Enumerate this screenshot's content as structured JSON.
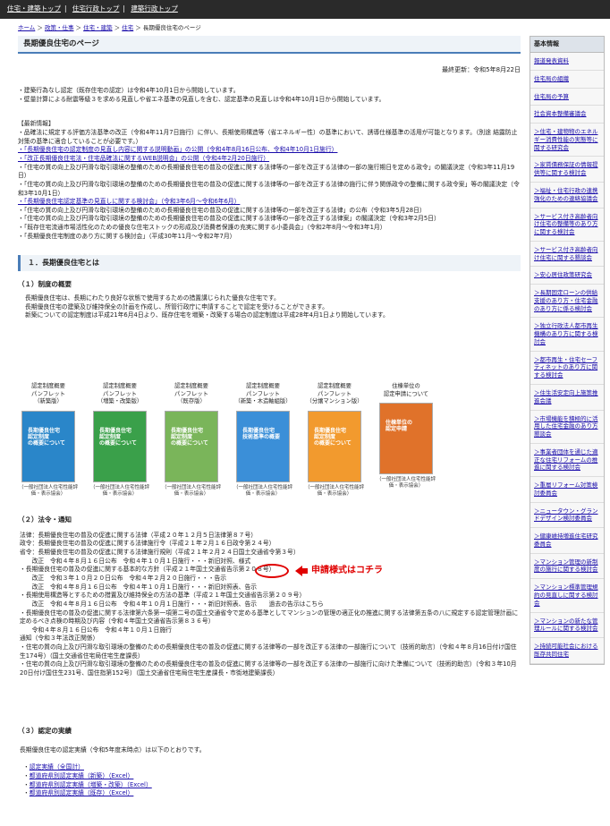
{
  "topnav": {
    "items": [
      "住宅・建築トップ",
      "住宅行政トップ",
      "建築行政トップ"
    ]
  },
  "breadcrumb": {
    "items": [
      "ホーム",
      "政策・仕事",
      "住宅・建築",
      "住宅"
    ],
    "current": "長期優良住宅のページ"
  },
  "page": {
    "title": "長期優良住宅のページ",
    "updated": "最終更新：令和5年8月22日"
  },
  "intro": [
    "・建築行為なし認定（既存住宅の認定）は令和4年10月1日から開始しています。",
    "・壁量計算による耐震等級３を求める見直しや省エネ基準の見直しを含む、認定基準の見直しは令和4年10月1日から開始しています。"
  ],
  "news": {
    "heading": "【最新情報】",
    "lines": [
      "・品確法に規定する評価方法基準の改正（令和4年11月7日施行）に伴い、長期使用構造等（省エネルギー性）の基準において、誘導仕様基準の活用が可能となります。（別途 結露防止対策の基準に適合していることが必要です。）",
      "・「長期優良住宅の認定制度の見直し内容に関する説明動画」の公開（令和4年8月16日公布、令和4年10月1日施行）",
      "・「改正長期優良住宅法・住宅品確法に関するWEB説明会」の公開（令和4年2月20日施行）",
      "・「住宅の質の向上及び円滑な取引環境の整備のための長期優良住宅の普及の促進に関する法律等の一部を改正する法律の一部の施行期日を定める政令」の閣議決定（令和3年11月19日）",
      "・「住宅の質の向上及び円滑な取引環境の整備のための長期優良住宅の普及の促進に関する法律等の一部を改正する法律の施行に伴う関係政令の整備に関する政令案」等の閣議決定（令和3年10月1日）",
      "・「長期優良住宅認定基準の見直しに関する検討会」（令和3年6月〜令和6年6月）",
      "・「住宅の質の向上及び円滑な取引環境の整備のための長期優良住宅の普及の促進に関する法律等の一部を改正する法律」の公布（令和3年5月28日）",
      "・「住宅の質の向上及び円滑な取引環境の整備のための長期優良住宅の普及の促進に関する法律等の一部を改正する法律案」の閣議決定（令和3年2月5日）",
      "・「既存住宅流通市場活性化のための優良な住宅ストックの形成及び消費者保護の充実に関する小委員会」（令和2年8月〜令和3年1月）",
      "・「長期優良住宅制度のあり方に関する検討会」（平成30年11月〜令和2年7月）"
    ]
  },
  "section1": {
    "title": "１．長期優良住宅とは"
  },
  "overview": {
    "title": "（１）制度の概要",
    "lines": [
      "長期優良住宅は、長期にわたり良好な状態で使用するための措置講じられた優良な住宅です。",
      "長期優良住宅の建築及び維持保全の計画を作成し、所管行政庁に申請することで認定を受けることができます。",
      "新築についての認定制度は平成21年6月4日より、既存住宅を増築・改築する場合の認定制度は平成28年4月1日より開始しています。"
    ]
  },
  "pamphlets": [
    {
      "label": "認定制度概要\nパンフレット\n（新築版）",
      "cover": "長期優良住宅\n認定制度\nの概要について",
      "color": "#2a86c9",
      "src": "（一般社団法人住宅性能評価・表示協会）"
    },
    {
      "label": "認定制度概要\nパンフレット\n（増築・改築版）",
      "cover": "長期優良住宅\n認定制度\nの概要について",
      "color": "#3aa04a",
      "src": "（一般社団法人住宅性能評価・表示協会）"
    },
    {
      "label": "認定制度概要\nパンフレット\n（既存版）",
      "cover": "長期優良住宅\n認定制度\nの概要について",
      "color": "#7ab55a",
      "src": "（一般社団法人住宅性能評価・表示協会）"
    },
    {
      "label": "認定制度概要\nパンフレット\n（新築・木造軸組版）",
      "cover": "長期優良住宅\n技術基準の概要",
      "color": "#3b8fd8",
      "src": "（一般社団法人住宅性能評価・表示協会）"
    },
    {
      "label": "認定制度概要\nパンフレット\n（分譲マンション版）",
      "cover": "長期優良住宅\n認定制度\nの概要について",
      "color": "#f29a2e",
      "src": "（一般社団法人住宅性能評価・表示協会）"
    },
    {
      "label": "住棟単位の\n認定申請について",
      "cover": "住棟単位の\n認定申請",
      "color": "#e0722a",
      "src": "（一般社団法人住宅性能評価・表示協会）"
    }
  ],
  "laws": {
    "title": "（２）法令・通知",
    "lines": [
      "法律：長期優良住宅の普及の促進に関する法律（平成２０年１２月５日法律第８７号）",
      "政令：長期優良住宅の普及の促進に関する法律施行令（平成２１年２月１６日政令第２４号）",
      "省令：長期優良住宅の普及の促進に関する法律施行規則（平成２１年２月２４日国土交通省令第３号）",
      "　　改正　令和４年８月１６日公布　令和４年１０月１日施行・・・新旧対照、様式",
      "・長期優良住宅の普及の促進に関する基本的な方針（平成２１年国土交通省告示第２０８号）",
      "　　改正　令和３年１０月２０日公布　令和４年２月２０日施行・・・告示",
      "　　改正　令和４年８月１６日公布　令和４年１０月１日施行・・・新旧対照表、告示",
      "・長期使用構造等とするための措置及び維持保全の方法の基準（平成２１年国土交通省告示第２０９号）",
      "　　改正　令和４年８月１６日公布　令和４年１０月１日施行・・・新旧対照表、告示　　過去の告示はこちら",
      "・長期優良住宅の普及の促進に関する法律第六条第一項第二号の国土交通省令で定める基準としてマンションの管理の適正化の推進に関する法律第五条の八に規定する認定管理計画に定めるべき点検の時期及び内容（令和４年国土交通省告示第８３６号）",
      "　　令和４年８月１６日公布　令和４年１０月１日施行",
      "通知（令和３年法改正関係）",
      "・住宅の質の向上及び円滑な取引環境の整備のための長期優良住宅の普及の促進に関する法律等の一部を改正する法律の一部施行について（技術的助言）（令和４年８月16日付け国住生174号）（国土交通省住宅局住宅生産課長）",
      "・住宅の質の向上及び円滑な取引環境の整備のための長期優良住宅の普及の促進に関する法律等の一部を改正する法律の一部施行に向けた準備について（技術的助言）（令和３年10月20日付け国住生231号、国住指第152号）（国土交通省住宅局住宅生産課長・市街地建築課長）"
    ],
    "note": "申請様式はコチラ"
  },
  "results": {
    "title": "（３）認定の実績",
    "intro": "長期優良住宅の認定実績（令和5年度末時点）は以下のとおりです。",
    "items": [
      "認定実績（全国計）",
      "都道府県別認定実績（新築）（Excel）",
      "都道府県別認定実績（増築・改築）（Excel）",
      "都道府県別認定実績（既存）（Excel）"
    ]
  },
  "sidebar": {
    "heading": "基本情報",
    "items": [
      "報道発表資料",
      "住宅局の組織",
      "住宅局の予算",
      "社会資本整備審議会",
      "＞住宅・建物物のエネルギー消費性能の実態等に関する研究会",
      "＞家賃債務保証の情報提供等に関する検討会",
      "＞福祉・住宅行政の連携強化のための連絡協議会",
      "＞サービス付き高齢者向け住宅の整備等のあり方に関する検討会",
      "＞サービス付き高齢者向け住宅に関する懇談会",
      "＞安心居住政策研究会",
      "＞長期固定ローンの供給支援のあり方・住宅金融のあり方に係る検討会",
      "＞独立行政法人都市再生機構のあり方に関する検討会",
      "＞都市再生・住宅セーフティネットのあり方に関する検討会",
      "＞住生活安定向上施策推進会議",
      "＞市場機能を積極的に活用した住宅金融のあり方懇談会",
      "＞事業者団体を通じた適正な住宅リフォームの推進に関する検討会",
      "＞重層リフォーム対策検討委員会",
      "＞ニュータウン・グランドデザイン検討委員会",
      "＞健康維持増進住宅研究委員会",
      "＞マンション管理の新制度の施行に関する検討会",
      "＞マンション標準管理規約の見直しに関する検討会",
      "＞マンションの新たな管理ルールに関する検討会",
      "＞持続可能社会における既存共同住宅"
    ]
  }
}
